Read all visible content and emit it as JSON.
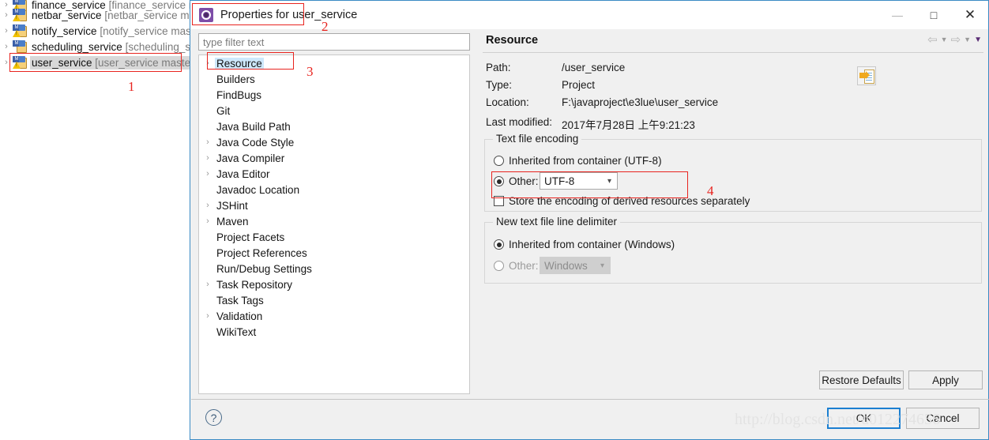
{
  "explorer": {
    "rows": [
      {
        "name": "finance_service",
        "branch": "[finance_service mast",
        "selected": false,
        "clipped": true
      },
      {
        "name": "netbar_service",
        "branch": "[netbar_service mas",
        "selected": false,
        "clipped": false
      },
      {
        "name": "notify_service",
        "branch": "[notify_service master",
        "selected": false,
        "clipped": false
      },
      {
        "name": "scheduling_service",
        "branch": "[scheduling_ser",
        "selected": false,
        "clipped": false
      },
      {
        "name": "user_service",
        "branch": "[user_service master]",
        "selected": true,
        "clipped": false
      }
    ]
  },
  "annotations": [
    {
      "id": "1",
      "label": "1"
    },
    {
      "id": "2",
      "label": "2"
    },
    {
      "id": "3",
      "label": "3"
    },
    {
      "id": "4",
      "label": "4"
    }
  ],
  "dialog": {
    "title": "Properties for user_service",
    "icon": "gear-icon",
    "window_buttons": {
      "minimize": "—",
      "maximize": "□",
      "close": "✕"
    },
    "filter": {
      "placeholder": "type filter text",
      "value": ""
    },
    "tree": [
      {
        "label": "Resource",
        "expandable": true,
        "selected": true
      },
      {
        "label": "Builders",
        "expandable": false,
        "selected": false
      },
      {
        "label": "FindBugs",
        "expandable": false,
        "selected": false
      },
      {
        "label": "Git",
        "expandable": false,
        "selected": false
      },
      {
        "label": "Java Build Path",
        "expandable": false,
        "selected": false
      },
      {
        "label": "Java Code Style",
        "expandable": true,
        "selected": false
      },
      {
        "label": "Java Compiler",
        "expandable": true,
        "selected": false
      },
      {
        "label": "Java Editor",
        "expandable": true,
        "selected": false
      },
      {
        "label": "Javadoc Location",
        "expandable": false,
        "selected": false
      },
      {
        "label": "JSHint",
        "expandable": true,
        "selected": false
      },
      {
        "label": "Maven",
        "expandable": true,
        "selected": false
      },
      {
        "label": "Project Facets",
        "expandable": false,
        "selected": false
      },
      {
        "label": "Project References",
        "expandable": false,
        "selected": false
      },
      {
        "label": "Run/Debug Settings",
        "expandable": false,
        "selected": false
      },
      {
        "label": "Task Repository",
        "expandable": true,
        "selected": false
      },
      {
        "label": "Task Tags",
        "expandable": false,
        "selected": false
      },
      {
        "label": "Validation",
        "expandable": true,
        "selected": false
      },
      {
        "label": "WikiText",
        "expandable": false,
        "selected": false
      }
    ],
    "page": {
      "heading": "Resource",
      "properties": [
        {
          "key": "Path:",
          "value": "/user_service"
        },
        {
          "key": "Type:",
          "value": "Project"
        },
        {
          "key": "Location:",
          "value": "F:\\javaproject\\e3lue\\user_service"
        }
      ],
      "last_modified_label": "Last modified:",
      "last_modified_value": "2017年7月28日 上午9:21:23",
      "encoding_group": {
        "legend": "Text file encoding",
        "inherited_label": "Inherited from container (UTF-8)",
        "inherited_selected": false,
        "other_label": "Other:",
        "other_selected": true,
        "other_value": "UTF-8",
        "store_derived_label": "Store the encoding of derived resources separately",
        "store_derived_checked": false
      },
      "delimiter_group": {
        "legend": "New text file line delimiter",
        "inherited_label": "Inherited from container (Windows)",
        "inherited_selected": true,
        "other_label": "Other:",
        "other_selected": false,
        "other_value": "Windows",
        "other_disabled": true
      }
    },
    "buttons": {
      "restore_defaults": "Restore Defaults",
      "apply": "Apply",
      "ok": "OK",
      "cancel": "Cancel"
    },
    "help": "?"
  },
  "watermark": "http://blog.csdn.net/u012274656",
  "colors": {
    "accent": "#1b7fd1",
    "annotation": "#e8241f",
    "selection": "#cde8fb",
    "dialog_bg": "#f0f0f0"
  }
}
